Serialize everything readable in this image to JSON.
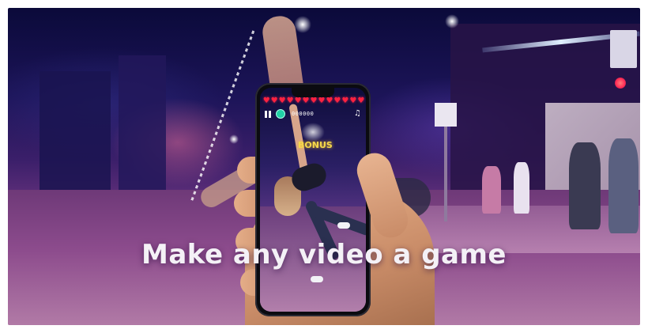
{
  "banner": {
    "headline": "Make any video a game",
    "accent_color": "#f5d84a"
  },
  "phone_game": {
    "lives_icon": "heart-icon",
    "lives_count": 13,
    "score": "000000",
    "bonus_label": "BONUS",
    "pause_icon": "pause-icon",
    "gem_icon": "gem-icon",
    "music_icon": "music-note-icon"
  }
}
